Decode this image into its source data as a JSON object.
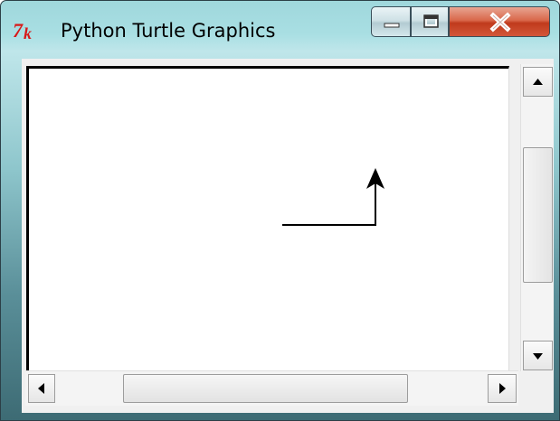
{
  "window": {
    "title": "Python Turtle Graphics",
    "app_icon": "tk-feather-icon",
    "controls": {
      "minimize": "minimize-icon",
      "maximize": "maximize-icon",
      "close": "close-icon"
    }
  },
  "canvas": {
    "background": "#ffffff",
    "drawing": "turtle path: line right then up, arrow pointing up"
  },
  "scrollbars": {
    "vertical": {
      "up": "arrow-up-icon",
      "down": "arrow-down-icon"
    },
    "horizontal": {
      "left": "arrow-left-icon",
      "right": "arrow-right-icon"
    }
  },
  "colors": {
    "accent_close": "#c03a1c",
    "frame": "#9fd7dc"
  }
}
